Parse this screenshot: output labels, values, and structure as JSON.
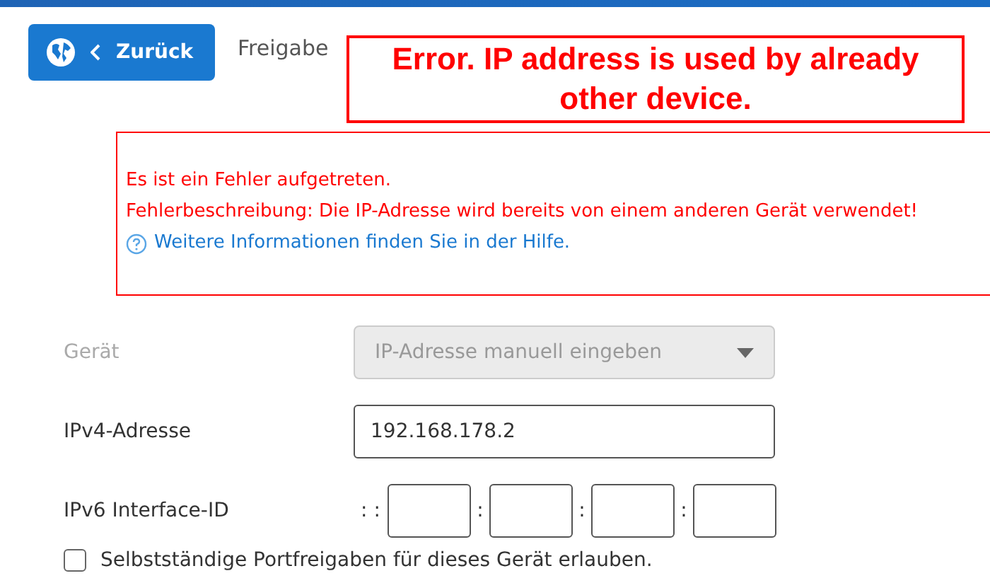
{
  "header": {
    "back_button": "Zurück",
    "title": "Freigabe"
  },
  "annotation": {
    "text": "Error. IP address is used by already other device."
  },
  "error": {
    "lines": [
      "Es ist ein Fehler aufgetreten.",
      "Fehlerbeschreibung: Die IP-Adresse wird bereits von einem anderen Gerät verwendet!"
    ],
    "help_link": "Weitere Informationen finden Sie in der Hilfe."
  },
  "form": {
    "device": {
      "label": "Gerät",
      "value": "IP-Adresse manuell eingeben",
      "disabled": true
    },
    "ipv4": {
      "label": "IPv4-Adresse",
      "value": "192.168.178.2"
    },
    "ipv6": {
      "label": "IPv6 Interface-ID",
      "prefix": ": :",
      "separator": ":",
      "parts": [
        {
          "kind": "blank"
        },
        {
          "kind": "blank"
        },
        {
          "kind": "blank"
        },
        {
          "kind": "blank"
        }
      ]
    },
    "checkbox": {
      "label": "Selbstständige Portfreigaben für dieses Gerät erlauben.",
      "checked": false
    }
  }
}
